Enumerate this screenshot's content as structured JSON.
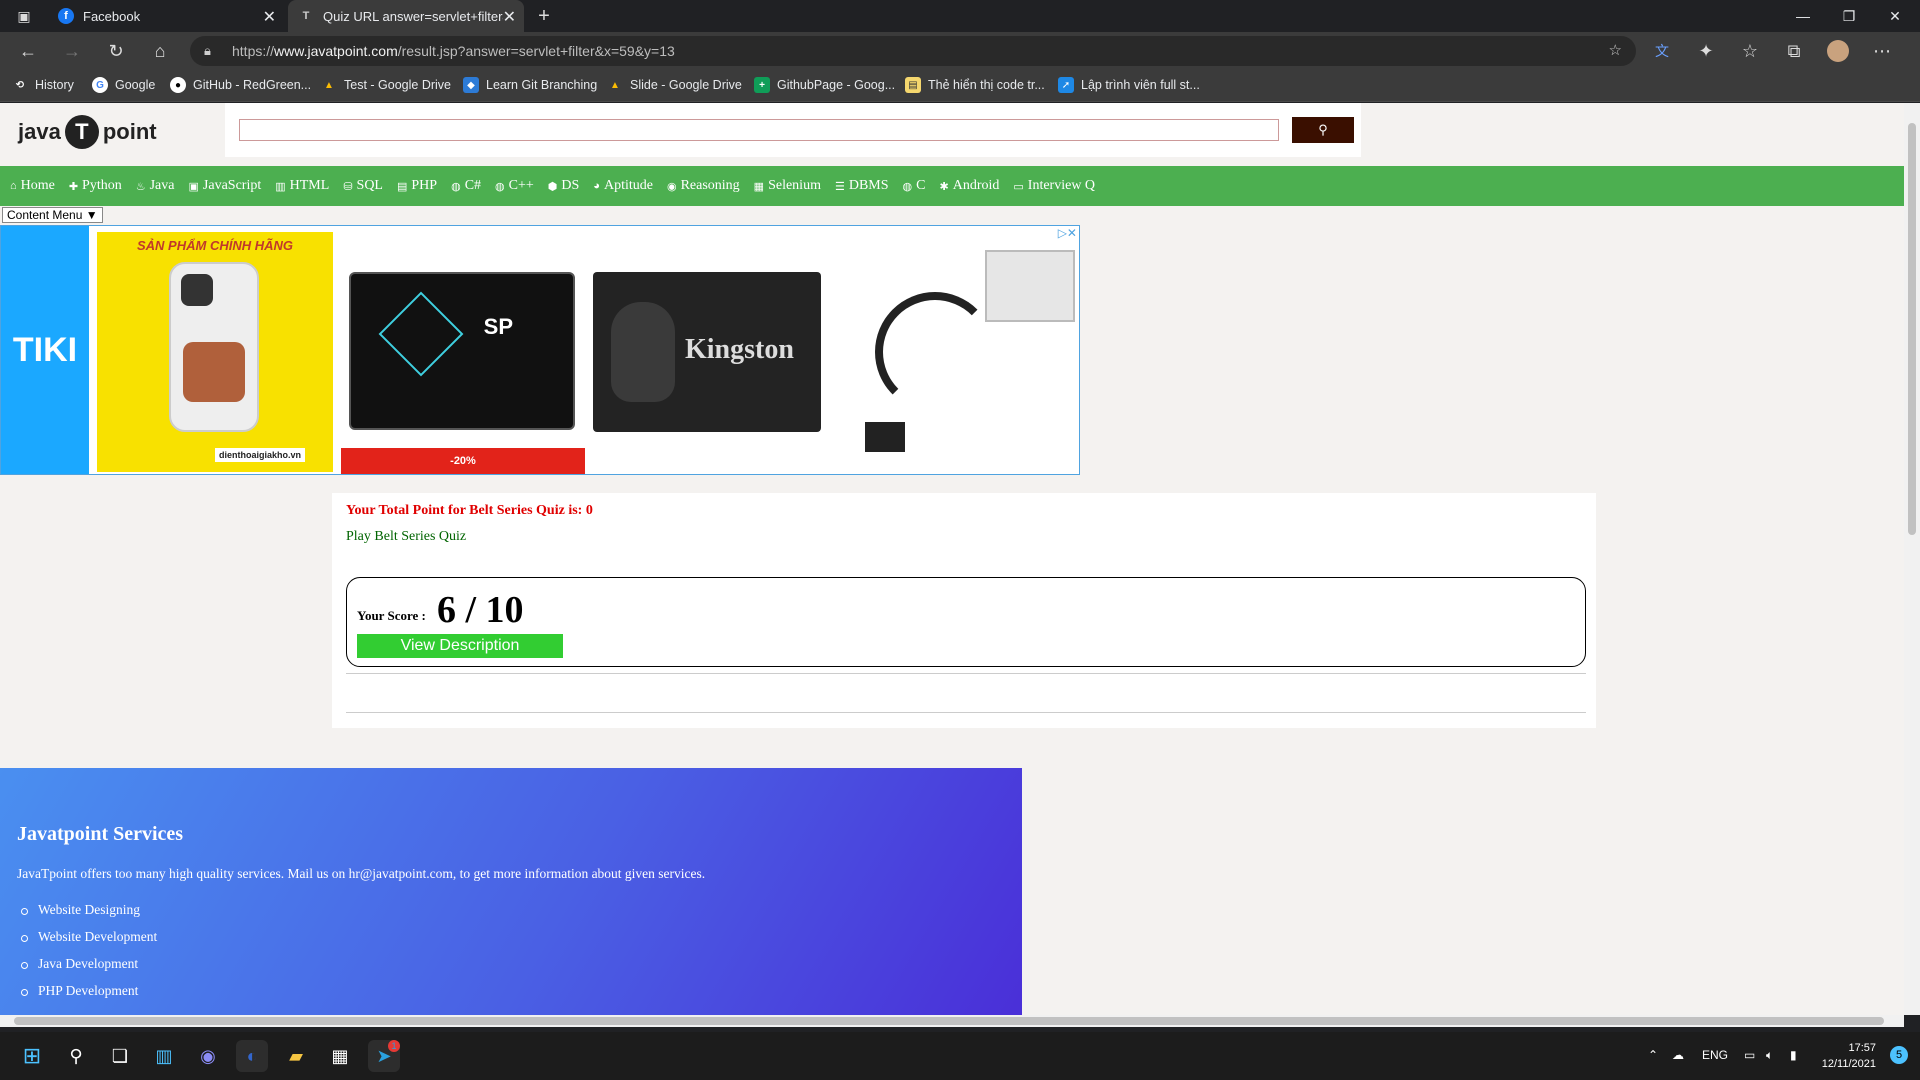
{
  "tabs": [
    {
      "title": "Facebook",
      "active": false
    },
    {
      "title": "Quiz URL answer=servlet+filter&",
      "active": true
    }
  ],
  "address": {
    "prefix": "https://",
    "host": "www.javatpoint.com",
    "path": "/result.jsp?answer=servlet+filter&x=59&y=13"
  },
  "bookmarks": [
    {
      "label": "History",
      "icon": "history-icon"
    },
    {
      "label": "Google",
      "icon": "google-icon"
    },
    {
      "label": "GitHub - RedGreen...",
      "icon": "github-icon"
    },
    {
      "label": "Test - Google Drive",
      "icon": "drive-icon"
    },
    {
      "label": "Learn Git Branching",
      "icon": "git-icon"
    },
    {
      "label": "Slide - Google Drive",
      "icon": "drive-icon"
    },
    {
      "label": "GithubPage - Goog...",
      "icon": "plus-icon"
    },
    {
      "label": "Thẻ hiển thị code tr...",
      "icon": "note-icon"
    },
    {
      "label": "Lập trình viên full st...",
      "icon": "runner-icon"
    }
  ],
  "site": {
    "logo_left": "java",
    "logo_mark": "T",
    "logo_right": "point",
    "search_placeholder": ""
  },
  "nav": [
    "Home",
    "Python",
    "Java",
    "JavaScript",
    "HTML",
    "SQL",
    "PHP",
    "C#",
    "C++",
    "DS",
    "Aptitude",
    "Reasoning",
    "Selenium",
    "DBMS",
    "C",
    "Android",
    "Interview Q"
  ],
  "content_menu": "Content Menu ▼",
  "ad": {
    "brand": "TIKI",
    "card1_header": "SẢN PHẨM CHÍNH HÃNG",
    "card1_shop": "dienthoaigiakho.vn",
    "card2_logo": "SP",
    "card2_discount": "-20%",
    "card3_brand": "Kingston"
  },
  "result": {
    "total_point": "Your Total Point for Belt Series Quiz is: 0",
    "play_link": "Play Belt Series Quiz",
    "score_label": "Your Score :",
    "score_value": "6 / 10",
    "view_button": "View Description"
  },
  "footer": {
    "title": "Javatpoint Services",
    "description": "JavaTpoint offers too many high quality services. Mail us on hr@javatpoint.com, to get more information about given services.",
    "services": [
      "Website Designing",
      "Website Development",
      "Java Development",
      "PHP Development"
    ]
  },
  "taskbar": {
    "lang": "ENG",
    "time": "17:57",
    "date": "12/11/2021",
    "notif_count": "5",
    "telegram_badge": "1"
  },
  "colors": {
    "nav_green": "#4caf50",
    "total_point_red": "#e00000",
    "play_link_green": "#006400",
    "view_button_green": "#32cd32",
    "search_button": "#3a0f00"
  }
}
